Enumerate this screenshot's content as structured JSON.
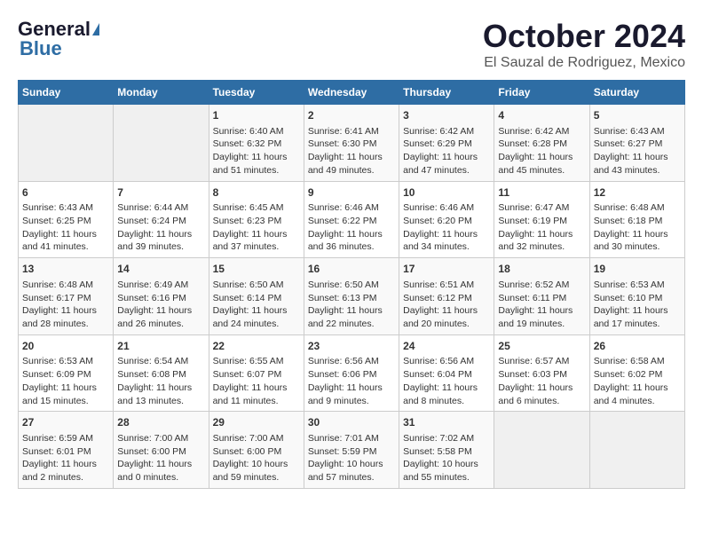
{
  "header": {
    "logo_general": "General",
    "logo_blue": "Blue",
    "month": "October 2024",
    "location": "El Sauzal de Rodriguez, Mexico"
  },
  "weekdays": [
    "Sunday",
    "Monday",
    "Tuesday",
    "Wednesday",
    "Thursday",
    "Friday",
    "Saturday"
  ],
  "weeks": [
    [
      {
        "day": "",
        "empty": true
      },
      {
        "day": "",
        "empty": true
      },
      {
        "day": "1",
        "sunrise": "6:40 AM",
        "sunset": "6:32 PM",
        "daylight": "11 hours and 51 minutes."
      },
      {
        "day": "2",
        "sunrise": "6:41 AM",
        "sunset": "6:30 PM",
        "daylight": "11 hours and 49 minutes."
      },
      {
        "day": "3",
        "sunrise": "6:42 AM",
        "sunset": "6:29 PM",
        "daylight": "11 hours and 47 minutes."
      },
      {
        "day": "4",
        "sunrise": "6:42 AM",
        "sunset": "6:28 PM",
        "daylight": "11 hours and 45 minutes."
      },
      {
        "day": "5",
        "sunrise": "6:43 AM",
        "sunset": "6:27 PM",
        "daylight": "11 hours and 43 minutes."
      }
    ],
    [
      {
        "day": "6",
        "sunrise": "6:43 AM",
        "sunset": "6:25 PM",
        "daylight": "11 hours and 41 minutes."
      },
      {
        "day": "7",
        "sunrise": "6:44 AM",
        "sunset": "6:24 PM",
        "daylight": "11 hours and 39 minutes."
      },
      {
        "day": "8",
        "sunrise": "6:45 AM",
        "sunset": "6:23 PM",
        "daylight": "11 hours and 37 minutes."
      },
      {
        "day": "9",
        "sunrise": "6:46 AM",
        "sunset": "6:22 PM",
        "daylight": "11 hours and 36 minutes."
      },
      {
        "day": "10",
        "sunrise": "6:46 AM",
        "sunset": "6:20 PM",
        "daylight": "11 hours and 34 minutes."
      },
      {
        "day": "11",
        "sunrise": "6:47 AM",
        "sunset": "6:19 PM",
        "daylight": "11 hours and 32 minutes."
      },
      {
        "day": "12",
        "sunrise": "6:48 AM",
        "sunset": "6:18 PM",
        "daylight": "11 hours and 30 minutes."
      }
    ],
    [
      {
        "day": "13",
        "sunrise": "6:48 AM",
        "sunset": "6:17 PM",
        "daylight": "11 hours and 28 minutes."
      },
      {
        "day": "14",
        "sunrise": "6:49 AM",
        "sunset": "6:16 PM",
        "daylight": "11 hours and 26 minutes."
      },
      {
        "day": "15",
        "sunrise": "6:50 AM",
        "sunset": "6:14 PM",
        "daylight": "11 hours and 24 minutes."
      },
      {
        "day": "16",
        "sunrise": "6:50 AM",
        "sunset": "6:13 PM",
        "daylight": "11 hours and 22 minutes."
      },
      {
        "day": "17",
        "sunrise": "6:51 AM",
        "sunset": "6:12 PM",
        "daylight": "11 hours and 20 minutes."
      },
      {
        "day": "18",
        "sunrise": "6:52 AM",
        "sunset": "6:11 PM",
        "daylight": "11 hours and 19 minutes."
      },
      {
        "day": "19",
        "sunrise": "6:53 AM",
        "sunset": "6:10 PM",
        "daylight": "11 hours and 17 minutes."
      }
    ],
    [
      {
        "day": "20",
        "sunrise": "6:53 AM",
        "sunset": "6:09 PM",
        "daylight": "11 hours and 15 minutes."
      },
      {
        "day": "21",
        "sunrise": "6:54 AM",
        "sunset": "6:08 PM",
        "daylight": "11 hours and 13 minutes."
      },
      {
        "day": "22",
        "sunrise": "6:55 AM",
        "sunset": "6:07 PM",
        "daylight": "11 hours and 11 minutes."
      },
      {
        "day": "23",
        "sunrise": "6:56 AM",
        "sunset": "6:06 PM",
        "daylight": "11 hours and 9 minutes."
      },
      {
        "day": "24",
        "sunrise": "6:56 AM",
        "sunset": "6:04 PM",
        "daylight": "11 hours and 8 minutes."
      },
      {
        "day": "25",
        "sunrise": "6:57 AM",
        "sunset": "6:03 PM",
        "daylight": "11 hours and 6 minutes."
      },
      {
        "day": "26",
        "sunrise": "6:58 AM",
        "sunset": "6:02 PM",
        "daylight": "11 hours and 4 minutes."
      }
    ],
    [
      {
        "day": "27",
        "sunrise": "6:59 AM",
        "sunset": "6:01 PM",
        "daylight": "11 hours and 2 minutes."
      },
      {
        "day": "28",
        "sunrise": "7:00 AM",
        "sunset": "6:00 PM",
        "daylight": "11 hours and 0 minutes."
      },
      {
        "day": "29",
        "sunrise": "7:00 AM",
        "sunset": "6:00 PM",
        "daylight": "10 hours and 59 minutes."
      },
      {
        "day": "30",
        "sunrise": "7:01 AM",
        "sunset": "5:59 PM",
        "daylight": "10 hours and 57 minutes."
      },
      {
        "day": "31",
        "sunrise": "7:02 AM",
        "sunset": "5:58 PM",
        "daylight": "10 hours and 55 minutes."
      },
      {
        "day": "",
        "empty": true
      },
      {
        "day": "",
        "empty": true
      }
    ]
  ]
}
